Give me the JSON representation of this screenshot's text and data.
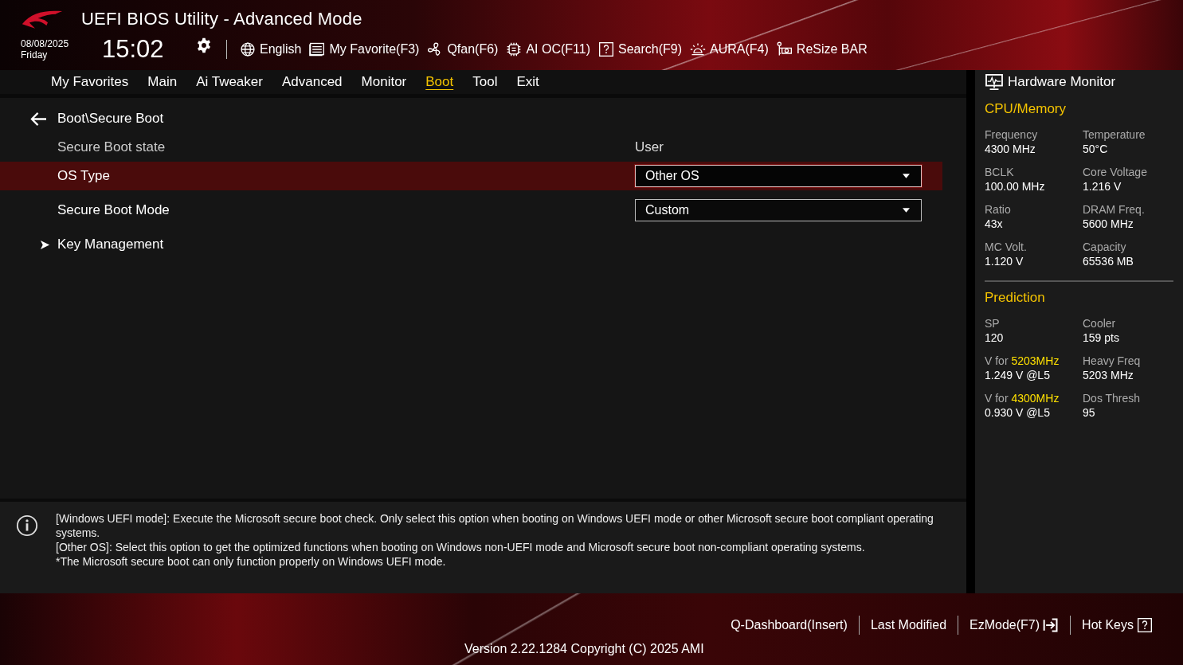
{
  "header": {
    "title": "UEFI BIOS Utility - Advanced Mode",
    "date": "08/08/2025",
    "day": "Friday",
    "time": "15:02",
    "toolbar": [
      {
        "label": "English"
      },
      {
        "label": "My Favorite(F3)"
      },
      {
        "label": "Qfan(F6)"
      },
      {
        "label": "AI OC(F11)"
      },
      {
        "label": "Search(F9)"
      },
      {
        "label": "AURA(F4)"
      },
      {
        "label": "ReSize BAR"
      }
    ]
  },
  "tabs": [
    {
      "label": "My Favorites",
      "selected": false
    },
    {
      "label": "Main",
      "selected": false
    },
    {
      "label": "Ai Tweaker",
      "selected": false
    },
    {
      "label": "Advanced",
      "selected": false
    },
    {
      "label": "Monitor",
      "selected": false
    },
    {
      "label": "Boot",
      "selected": true
    },
    {
      "label": "Tool",
      "selected": false
    },
    {
      "label": "Exit",
      "selected": false
    }
  ],
  "breadcrumb": "Boot\\Secure Boot",
  "settings": [
    {
      "kind": "info",
      "label": "Secure Boot state",
      "value": "User",
      "selected": false
    },
    {
      "kind": "dropdown",
      "label": "OS Type",
      "value": "Other OS",
      "selected": true
    },
    {
      "kind": "dropdown",
      "label": "Secure Boot Mode",
      "value": "Custom",
      "selected": false
    },
    {
      "kind": "submenu",
      "label": "Key Management",
      "selected": false
    }
  ],
  "help": [
    "[Windows UEFI mode]: Execute the Microsoft secure boot check. Only select this option when booting on Windows UEFI mode or other Microsoft secure boot compliant operating systems.",
    "[Other OS]: Select this option to get the optimized functions when booting on Windows non-UEFI mode and Microsoft secure boot non-compliant operating systems.",
    "*The Microsoft secure boot can only function properly on Windows UEFI mode."
  ],
  "hardware_monitor": {
    "title": "Hardware Monitor",
    "sections": [
      {
        "title": "CPU/Memory",
        "items": [
          {
            "label": "Frequency",
            "value": "4300 MHz"
          },
          {
            "label": "Temperature",
            "value": "50°C"
          },
          {
            "label": "BCLK",
            "value": "100.00 MHz"
          },
          {
            "label": "Core Voltage",
            "value": "1.216 V"
          },
          {
            "label": "Ratio",
            "value": "43x"
          },
          {
            "label": "DRAM Freq.",
            "value": "5600 MHz"
          },
          {
            "label": "MC Volt.",
            "value": "1.120 V"
          },
          {
            "label": "Capacity",
            "value": "65536 MB"
          }
        ]
      },
      {
        "title": "Prediction",
        "items": [
          {
            "label": "SP",
            "value": "120"
          },
          {
            "label": "Cooler",
            "value": "159 pts"
          },
          {
            "label": "V for **5203MHz**",
            "value": "1.249 V @L5"
          },
          {
            "label": "Heavy Freq",
            "value": "5203 MHz"
          },
          {
            "label": "V for **4300MHz**",
            "value": "0.930 V @L5"
          },
          {
            "label": "Dos Thresh",
            "value": "95"
          }
        ]
      }
    ]
  },
  "footer": {
    "links": [
      "Q-Dashboard(Insert)",
      "Last Modified",
      "EzMode(F7)",
      "Hot Keys"
    ],
    "version": "Version 2.22.1284 Copyright (C) 2025 AMI"
  }
}
